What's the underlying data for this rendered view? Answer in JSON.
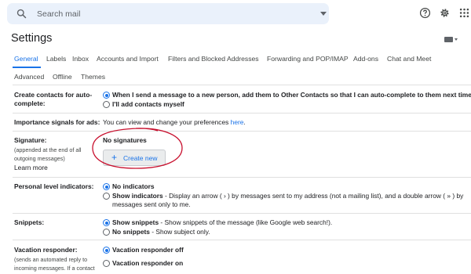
{
  "search": {
    "placeholder": "Search mail"
  },
  "header": {
    "title": "Settings"
  },
  "tabs_row1": [
    "General",
    "Labels",
    "Inbox",
    "Accounts and Import",
    "Filters and Blocked Addresses",
    "Forwarding and POP/IMAP",
    "Add-ons",
    "Chat and Meet"
  ],
  "tabs_row2": [
    "Advanced",
    "Offline",
    "Themes"
  ],
  "active_tab": "General",
  "settings": {
    "create_contacts": {
      "label_line1": "Create contacts for auto-",
      "label_line2": "complete:",
      "opt1": "When I send a message to a new person, add them to Other Contacts so that I can auto-complete to them next time",
      "opt2": "I'll add contacts myself",
      "selected": 1
    },
    "importance": {
      "label": "Importance signals for ads:",
      "text": "You can view and change your preferences ",
      "link": "here",
      "tail": "."
    },
    "signature": {
      "label": "Signature:",
      "sub1": "(appended at the end of all",
      "sub2": "outgoing messages)",
      "learn_more": "Learn more",
      "none_text": "No signatures",
      "create_button": "Create new"
    },
    "personal_level": {
      "label": "Personal level indicators:",
      "opt1": "No indicators",
      "opt2_bold": "Show indicators",
      "opt2_rest": " - Display an arrow ( › ) by messages sent to my address (not a mailing list), and a double arrow ( » ) by",
      "opt2_line2": "messages sent only to me.",
      "selected": 1
    },
    "snippets": {
      "label": "Snippets:",
      "opt1_bold": "Show snippets",
      "opt1_rest": " - Show snippets of the message (like Google web search!).",
      "opt2_bold": "No snippets",
      "opt2_rest": " - Show subject only.",
      "selected": 1
    },
    "vacation": {
      "label": "Vacation responder:",
      "sub1": "(sends an automated reply to",
      "sub2": "incoming messages. If a contact",
      "opt1": "Vacation responder off",
      "opt2": "Vacation responder on",
      "selected": 1
    }
  },
  "colors": {
    "accent": "#1a73e8",
    "search_bg": "#eaf1fb",
    "annotation": "#c8102e"
  },
  "icons": [
    "search-icon",
    "dropdown-caret-icon",
    "help-icon",
    "gear-icon",
    "apps-grid-icon",
    "keyboard-icon",
    "plus-icon"
  ]
}
